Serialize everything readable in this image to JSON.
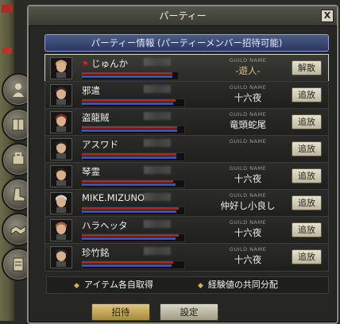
{
  "window": {
    "title": "パーティー",
    "close_label": "X"
  },
  "header": {
    "label": "パーティー情報 (パーティーメンバー招待可能)"
  },
  "guild_label": "GUILD NAME",
  "members": [
    {
      "name": "じゅんか",
      "guild": "-遊人-",
      "action": "解散",
      "leader": true,
      "hp": 0.95,
      "mp": 0.95
    },
    {
      "name": "邪遣",
      "guild": "十六夜",
      "action": "追放",
      "leader": false,
      "hp": 0.92,
      "mp": 0.9
    },
    {
      "name": "盗龍賊",
      "guild": "竜頭蛇尾",
      "action": "追放",
      "leader": false,
      "hp": 0.94,
      "mp": 0.94
    },
    {
      "name": "アスワド",
      "guild": "",
      "action": "追放",
      "leader": false,
      "hp": 0.93,
      "mp": 0.93
    },
    {
      "name": "琴霊",
      "guild": "十六夜",
      "action": "追放",
      "leader": false,
      "hp": 0.9,
      "mp": 0.92
    },
    {
      "name": "MIKE.MIZUNO",
      "guild": "仲好し小良し",
      "action": "追放",
      "leader": false,
      "hp": 0.95,
      "mp": 0.93
    },
    {
      "name": "ハラヘッタ",
      "guild": "十六夜",
      "action": "追放",
      "leader": false,
      "hp": 0.95,
      "mp": 0.92
    },
    {
      "name": "珍竹銘",
      "guild": "十六夜",
      "action": "追放",
      "leader": false,
      "hp": 0.9,
      "mp": 0.88
    }
  ],
  "options": {
    "item_rule": "アイテム各自取得",
    "exp_rule": "経験値の共同分配"
  },
  "buttons": {
    "invite": "招待",
    "settings": "設定"
  },
  "colors": {
    "hp": "#c01e1e",
    "mp": "#3a4fd6",
    "header": "#2c3760",
    "accent": "#e0c184"
  }
}
